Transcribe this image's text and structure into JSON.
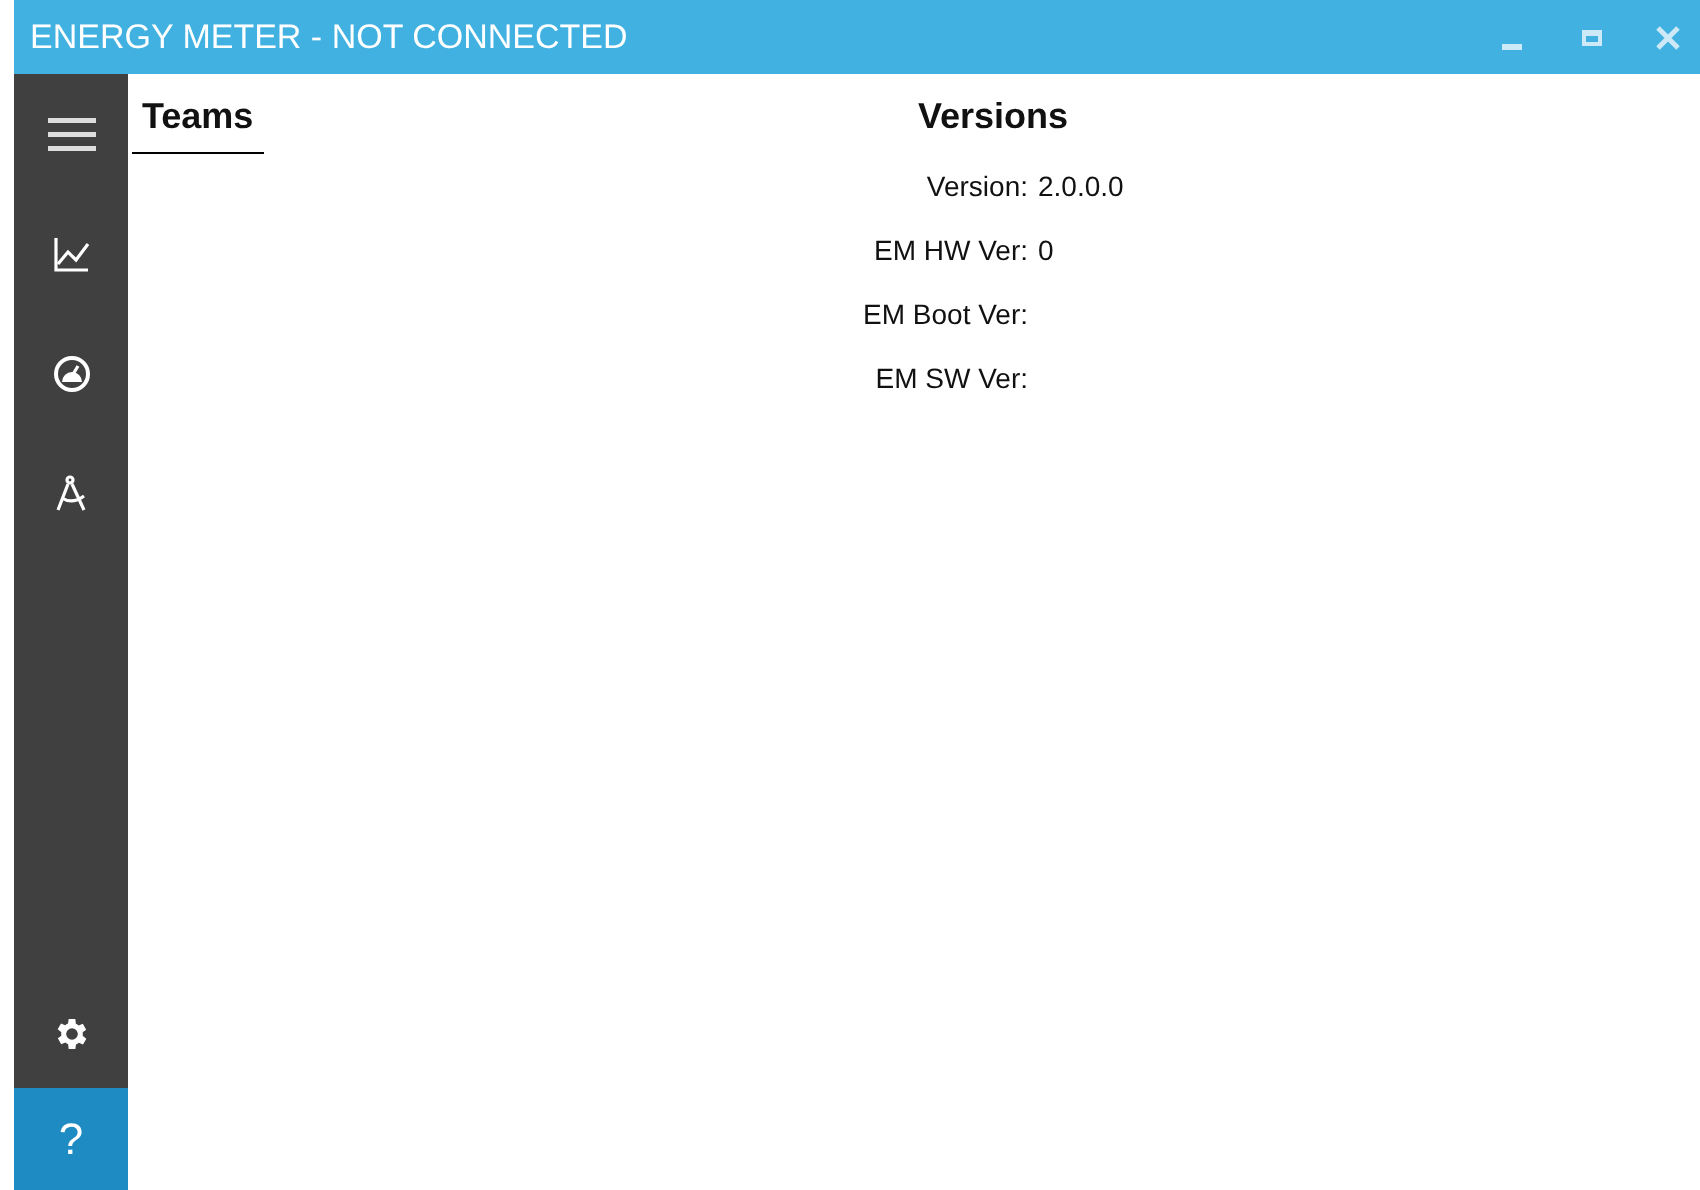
{
  "window": {
    "title": "ENERGY METER - NOT CONNECTED"
  },
  "sidebar": {
    "items": [
      {
        "kind": "menu"
      },
      {
        "kind": "chart"
      },
      {
        "kind": "gauge"
      },
      {
        "kind": "compass"
      }
    ],
    "bottom": [
      {
        "kind": "settings"
      },
      {
        "kind": "help",
        "label": "?"
      }
    ]
  },
  "tabs": [
    {
      "label": "Teams",
      "selected": true
    }
  ],
  "versions": {
    "title": "Versions",
    "rows": [
      {
        "label": "Version:",
        "value": "2.0.0.0"
      },
      {
        "label": "EM HW Ver:",
        "value": "0"
      },
      {
        "label": "EM Boot Ver:"
      },
      {
        "label": "EM SW Ver:"
      }
    ]
  }
}
